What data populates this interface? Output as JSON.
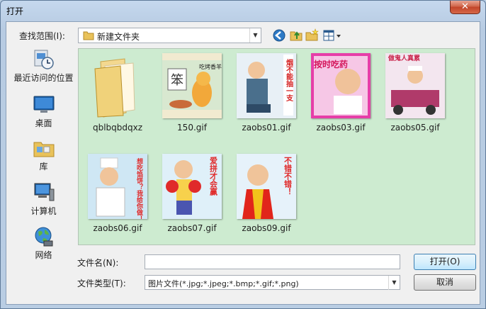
{
  "window": {
    "title": "打开",
    "close_glyph": "✕"
  },
  "toolbar": {
    "lookin_label": "查找范围(I):",
    "lookin_value": "新建文件夹",
    "buttons": [
      "back-icon",
      "up-folder-icon",
      "new-folder-icon",
      "view-menu-icon"
    ]
  },
  "places": [
    {
      "label": "最近访问的位置",
      "icon": "recent-places-icon"
    },
    {
      "label": "桌面",
      "icon": "desktop-icon"
    },
    {
      "label": "库",
      "icon": "libraries-icon"
    },
    {
      "label": "计算机",
      "icon": "computer-icon"
    },
    {
      "label": "网络",
      "icon": "network-icon"
    }
  ],
  "files": [
    {
      "name": "qblbqbdqxz",
      "kind": "folder"
    },
    {
      "name": "150.gif",
      "kind": "image",
      "caption": "吃烤香羊",
      "sign": "笨"
    },
    {
      "name": "zaobs01.gif",
      "kind": "image",
      "caption": "烟不能抽一支"
    },
    {
      "name": "zaobs03.gif",
      "kind": "image",
      "caption": "按时吃药"
    },
    {
      "name": "zaobs05.gif",
      "kind": "image",
      "caption": "做鬼人真累"
    },
    {
      "name": "zaobs06.gif",
      "kind": "image",
      "caption": "想吃馅饼？我给你做！"
    },
    {
      "name": "zaobs07.gif",
      "kind": "image",
      "caption": "爱拼才会赢"
    },
    {
      "name": "zaobs09.gif",
      "kind": "image",
      "caption": "不错不错！"
    }
  ],
  "form": {
    "filename_label": "文件名(N):",
    "filename_value": "",
    "filetype_label": "文件类型(T):",
    "filetype_value": "图片文件(*.jpg;*.jpeg;*.bmp;*.gif;*.png)",
    "open_button": "打开(O)",
    "cancel_button": "取消"
  },
  "colors": {
    "list_bg": "#cdebd0",
    "chrome": "#b9cde3"
  }
}
